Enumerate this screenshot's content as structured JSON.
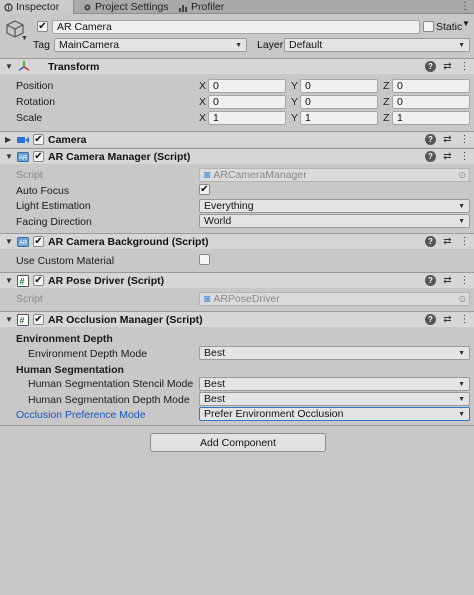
{
  "tabs": [
    {
      "label": "Inspector",
      "icon": "inspector-icon"
    },
    {
      "label": "Project Settings",
      "icon": "gear-icon"
    },
    {
      "label": "Profiler",
      "icon": "profiler-icon"
    }
  ],
  "object": {
    "name": "AR Camera",
    "active": true,
    "static_label": "Static",
    "tag_label": "Tag",
    "tag_value": "MainCamera",
    "layer_label": "Layer",
    "layer_value": "Default"
  },
  "transform": {
    "title": "Transform",
    "rows": [
      {
        "label": "Position",
        "x": "0",
        "y": "0",
        "z": "0"
      },
      {
        "label": "Rotation",
        "x": "0",
        "y": "0",
        "z": "0"
      },
      {
        "label": "Scale",
        "x": "1",
        "y": "1",
        "z": "1"
      }
    ],
    "axes": {
      "x": "X",
      "y": "Y",
      "z": "Z"
    }
  },
  "components": {
    "camera": {
      "title": "Camera"
    },
    "ar_camera_manager": {
      "title": "AR Camera Manager (Script)",
      "script_label": "Script",
      "script_value": "ARCameraManager",
      "auto_focus_label": "Auto Focus",
      "auto_focus": true,
      "light_estimation_label": "Light Estimation",
      "light_estimation_value": "Everything",
      "facing_label": "Facing Direction",
      "facing_value": "World"
    },
    "ar_camera_background": {
      "title": "AR Camera Background (Script)",
      "custom_material_label": "Use Custom Material",
      "custom_material": false
    },
    "ar_pose_driver": {
      "title": "AR Pose Driver (Script)",
      "script_label": "Script",
      "script_value": "ARPoseDriver"
    },
    "ar_occlusion_manager": {
      "title": "AR Occlusion Manager (Script)",
      "env_depth_header": "Environment Depth",
      "env_depth_mode_label": "Environment Depth Mode",
      "env_depth_mode_value": "Best",
      "human_seg_header": "Human Segmentation",
      "stencil_label": "Human Segmentation Stencil Mode",
      "stencil_value": "Best",
      "depth_label": "Human Segmentation Depth Mode",
      "depth_value": "Best",
      "preference_label": "Occlusion Preference Mode",
      "preference_value": "Prefer Environment Occlusion"
    }
  },
  "add_component_label": "Add Component",
  "colors": {
    "accent": "#1a52b8",
    "panel": "#c8c8c8",
    "header": "#d6d6d6"
  }
}
